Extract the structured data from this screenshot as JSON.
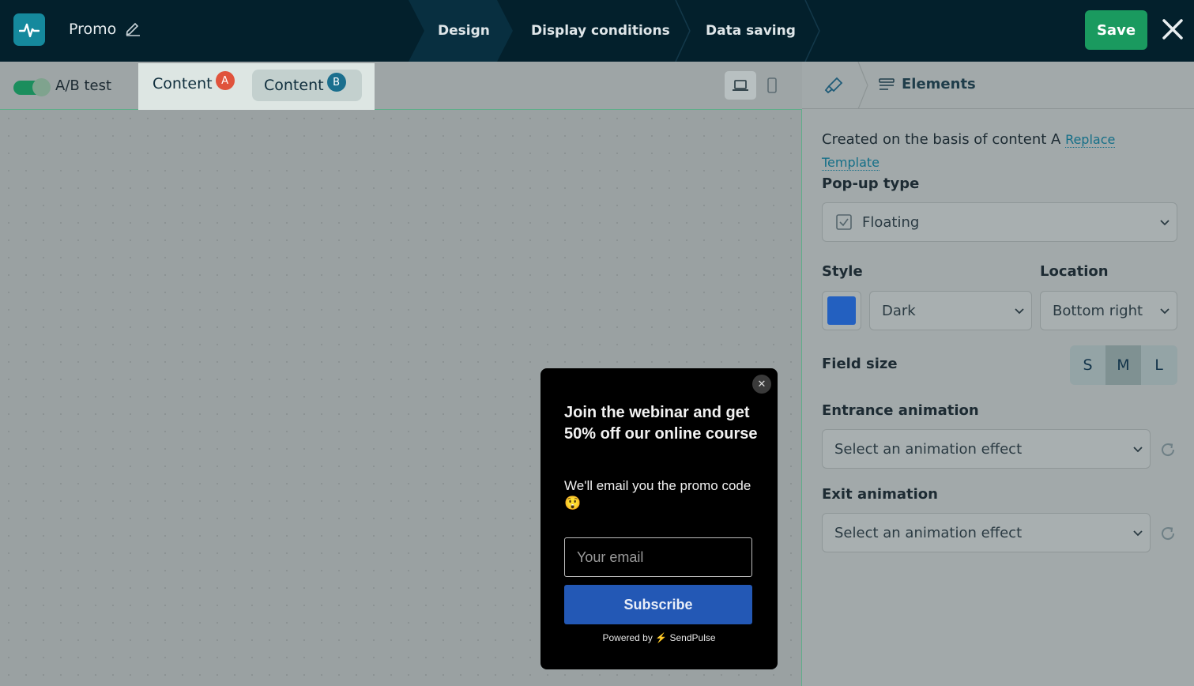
{
  "header": {
    "title": "Promo",
    "steps": [
      "Design",
      "Display conditions",
      "Data saving"
    ],
    "save_label": "Save"
  },
  "toolbar": {
    "ab_label": "A/B test",
    "tab_a_label": "Content",
    "tab_a_badge": "A",
    "tab_b_label": "Content",
    "tab_b_badge": "B"
  },
  "popup": {
    "heading": "Join the webinar and get 50% off our online course",
    "subtext": "We'll email you the promo code 😲",
    "email_placeholder": "Your email",
    "button_label": "Subscribe",
    "powered_prefix": "Powered by",
    "powered_brand": "SendPulse"
  },
  "panel": {
    "elements_label": "Elements",
    "created_text": "Created on the basis of content A",
    "replace_link": "Replace",
    "template_link": "Template",
    "popup_type_label": "Pop-up type",
    "popup_type_value": "Floating",
    "style_label": "Style",
    "style_value": "Dark",
    "style_color": "#2360c0",
    "location_label": "Location",
    "location_value": "Bottom right",
    "field_size_label": "Field size",
    "sizes": [
      "S",
      "M",
      "L"
    ],
    "active_size": "M",
    "entrance_label": "Entrance animation",
    "entrance_value": "Select an animation effect",
    "exit_label": "Exit animation",
    "exit_value": "Select an animation effect"
  },
  "colors": {
    "topbar": "#03202c",
    "accent_green": "#1a9a5f",
    "subscribe_blue": "#2358b5",
    "badge_a": "#e0533c",
    "badge_b": "#1b6f8e"
  }
}
